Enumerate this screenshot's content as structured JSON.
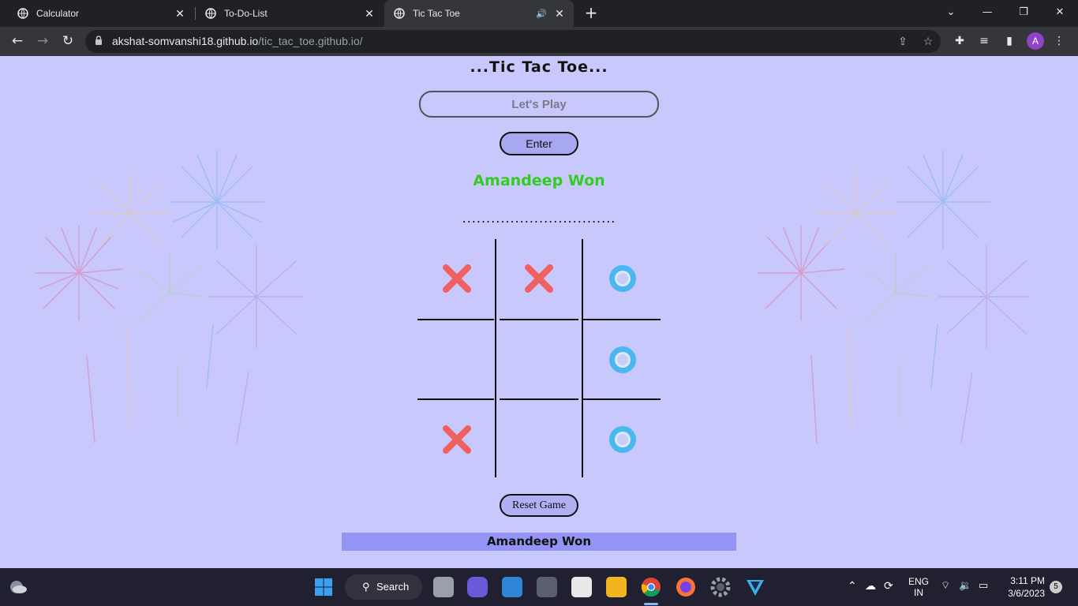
{
  "browser": {
    "tabs": [
      {
        "title": "Calculator",
        "active": false
      },
      {
        "title": "To-Do-List",
        "active": false
      },
      {
        "title": "Tic Tac Toe",
        "active": true
      }
    ],
    "url_host": "akshat-somvanshi18.github.io",
    "url_path": "/tic_tac_toe.github.io/",
    "profile_initial": "A"
  },
  "page": {
    "title": "...Tic Tac Toe...",
    "name_input_placeholder": "Let's Play",
    "enter_label": "Enter",
    "winner_message": "Amandeep Won",
    "separator": "................................",
    "board": [
      "X",
      "X",
      "O",
      "",
      "",
      "O",
      "X",
      "",
      "O"
    ],
    "reset_label": "Reset Game",
    "footer_message": "Amandeep Won"
  },
  "colors": {
    "page_bg": "#c8c8fc",
    "winner_text": "#33cc22",
    "x_mark": "#f06060",
    "o_mark": "#4ab8ee",
    "footer_bg": "#9494f4"
  },
  "taskbar": {
    "search_label": "Search",
    "lang_top": "ENG",
    "lang_bottom": "IN",
    "time": "3:11 PM",
    "date": "3/6/2023",
    "notification_count": "5"
  }
}
